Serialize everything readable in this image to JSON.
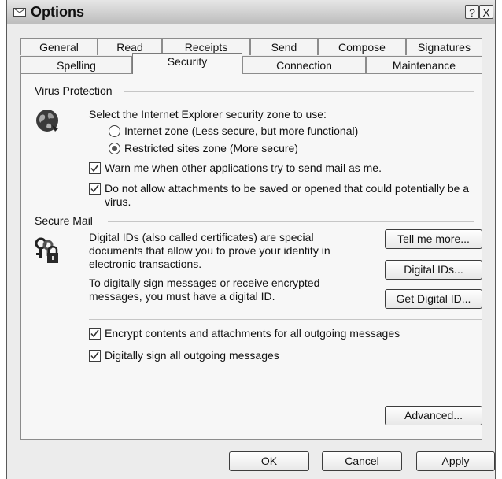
{
  "window": {
    "title": "Options",
    "help_glyph": "?",
    "close_glyph": "X"
  },
  "tabs_row1": [
    "General",
    "Read",
    "Receipts",
    "Send",
    "Compose",
    "Signatures"
  ],
  "tabs_row2": [
    "Spelling",
    "Security",
    "Connection",
    "Maintenance"
  ],
  "active_tab": "Security",
  "virus": {
    "heading": "Virus Protection",
    "zone_prompt": "Select the Internet Explorer security zone to use:",
    "zone_internet": "Internet zone (Less secure, but more functional)",
    "zone_restricted": "Restricted sites zone (More secure)",
    "zone_selected": "restricted",
    "warn_label": "Warn me when other applications try to send mail as me.",
    "warn_checked": true,
    "attach_line1": "Do not allow attachments to be saved or opened that could potentially be a",
    "attach_line2": "virus.",
    "attach_checked": true
  },
  "secure": {
    "heading": "Secure Mail",
    "desc_line1": "Digital IDs (also called certificates) are special",
    "desc_line2": "documents that allow you to prove your identity in",
    "desc_line3": "electronic transactions.",
    "desc_line4": "To digitally sign messages or receive encrypted",
    "desc_line5": "messages, you must have a digital ID.",
    "tell_more": "Tell me more...",
    "digital_ids": "Digital IDs...",
    "get_digital_id": "Get Digital ID...",
    "encrypt_label": "Encrypt contents and attachments for all outgoing messages",
    "encrypt_checked": true,
    "sign_label": "Digitally sign all outgoing messages",
    "sign_checked": true,
    "advanced": "Advanced..."
  },
  "footer": {
    "ok": "OK",
    "cancel": "Cancel",
    "apply": "Apply"
  },
  "icons": {
    "virus": "globe-icon",
    "secure": "keys-lock-icon",
    "title": "options-icon"
  }
}
